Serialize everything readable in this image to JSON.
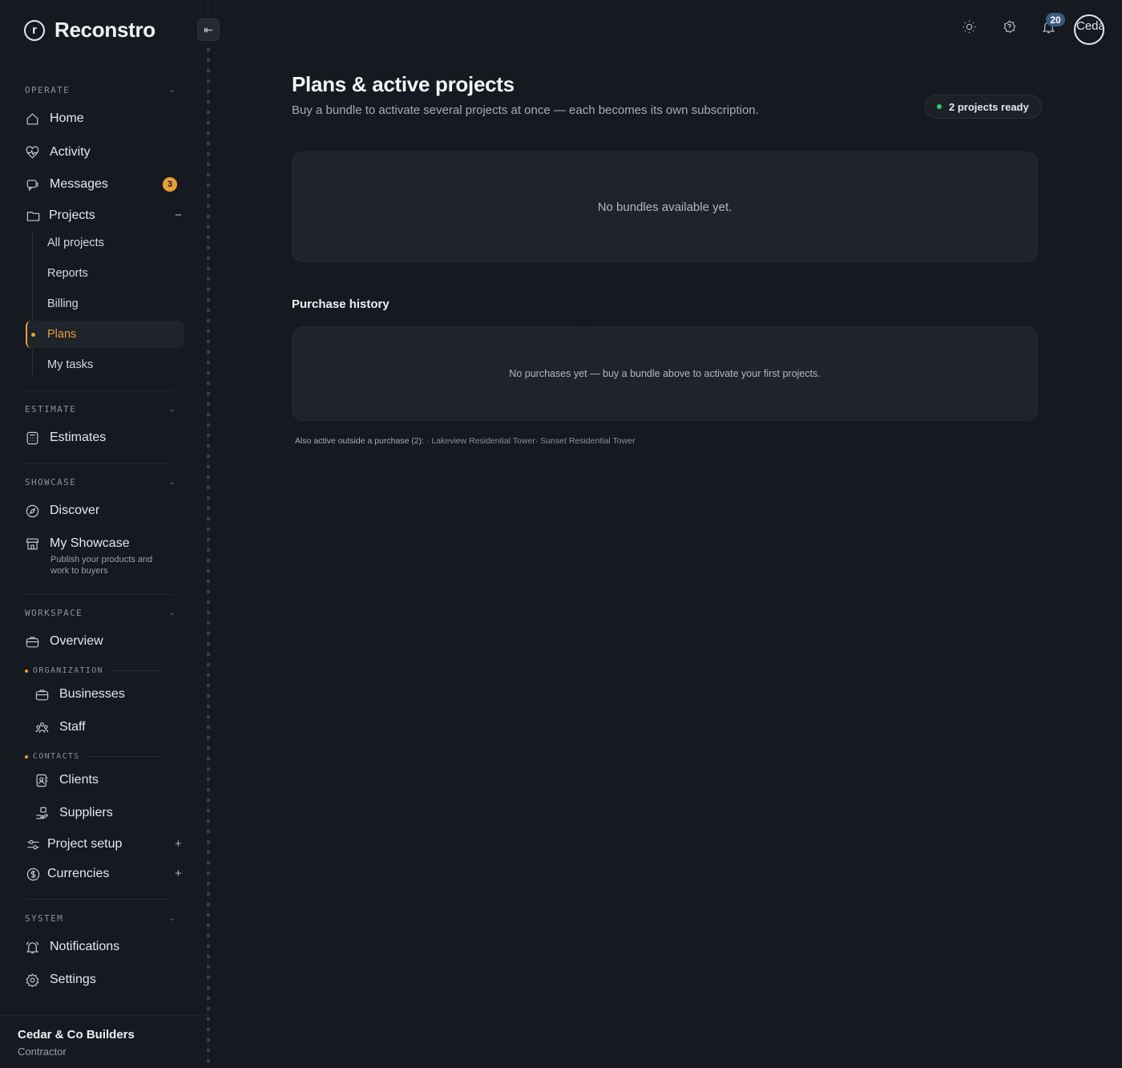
{
  "app": {
    "brand_name": "Reconstro",
    "brand_initial": "r"
  },
  "sidebar": {
    "sections": {
      "operate": "OPERATE",
      "estimate": "ESTIMATE",
      "showcase": "SHOWCASE",
      "workspace": "WORKSPACE",
      "system": "SYSTEM"
    },
    "items": {
      "home": "Home",
      "activity": "Activity",
      "messages": "Messages",
      "messages_badge": "3",
      "projects": "Projects",
      "projects_toggle": "−",
      "estimates": "Estimates",
      "discover": "Discover",
      "my_showcase": "My Showcase",
      "my_showcase_desc": "Publish your products and work to buyers",
      "overview": "Overview",
      "businesses": "Businesses",
      "staff": "Staff",
      "clients": "Clients",
      "suppliers": "Suppliers",
      "project_setup": "Project setup",
      "currencies": "Currencies",
      "expand_toggle": "+",
      "notifications": "Notifications",
      "settings": "Settings"
    },
    "project_subitems": {
      "all_projects": "All projects",
      "reports": "Reports",
      "billing": "Billing",
      "plans": "Plans",
      "my_tasks": "My tasks"
    },
    "groups": {
      "organization": "ORGANIZATION",
      "contacts": "CONTACTS"
    },
    "footer": {
      "company": "Cedar & Co Builders",
      "role": "Contractor"
    }
  },
  "topbar": {
    "notifications_count": "20",
    "avatar_text": "Cedar"
  },
  "main": {
    "title": "Plans & active projects",
    "subtitle": "Buy a bundle to activate several projects at once — each becomes its own subscription.",
    "ready_pill": "2 projects ready",
    "bundles_empty": "No bundles available yet.",
    "purchase_history_title": "Purchase history",
    "purchases_empty": "No purchases yet — buy a bundle above to activate your first projects.",
    "also_active_label": "Also active outside a purchase (2):",
    "also_active_projects": " · Lakeview Residential Tower· Sunset Residential Tower"
  },
  "colors": {
    "accent": "#e2a23b",
    "status_ready": "#2fc96b",
    "background": "#16191f",
    "card": "#1f232a"
  }
}
